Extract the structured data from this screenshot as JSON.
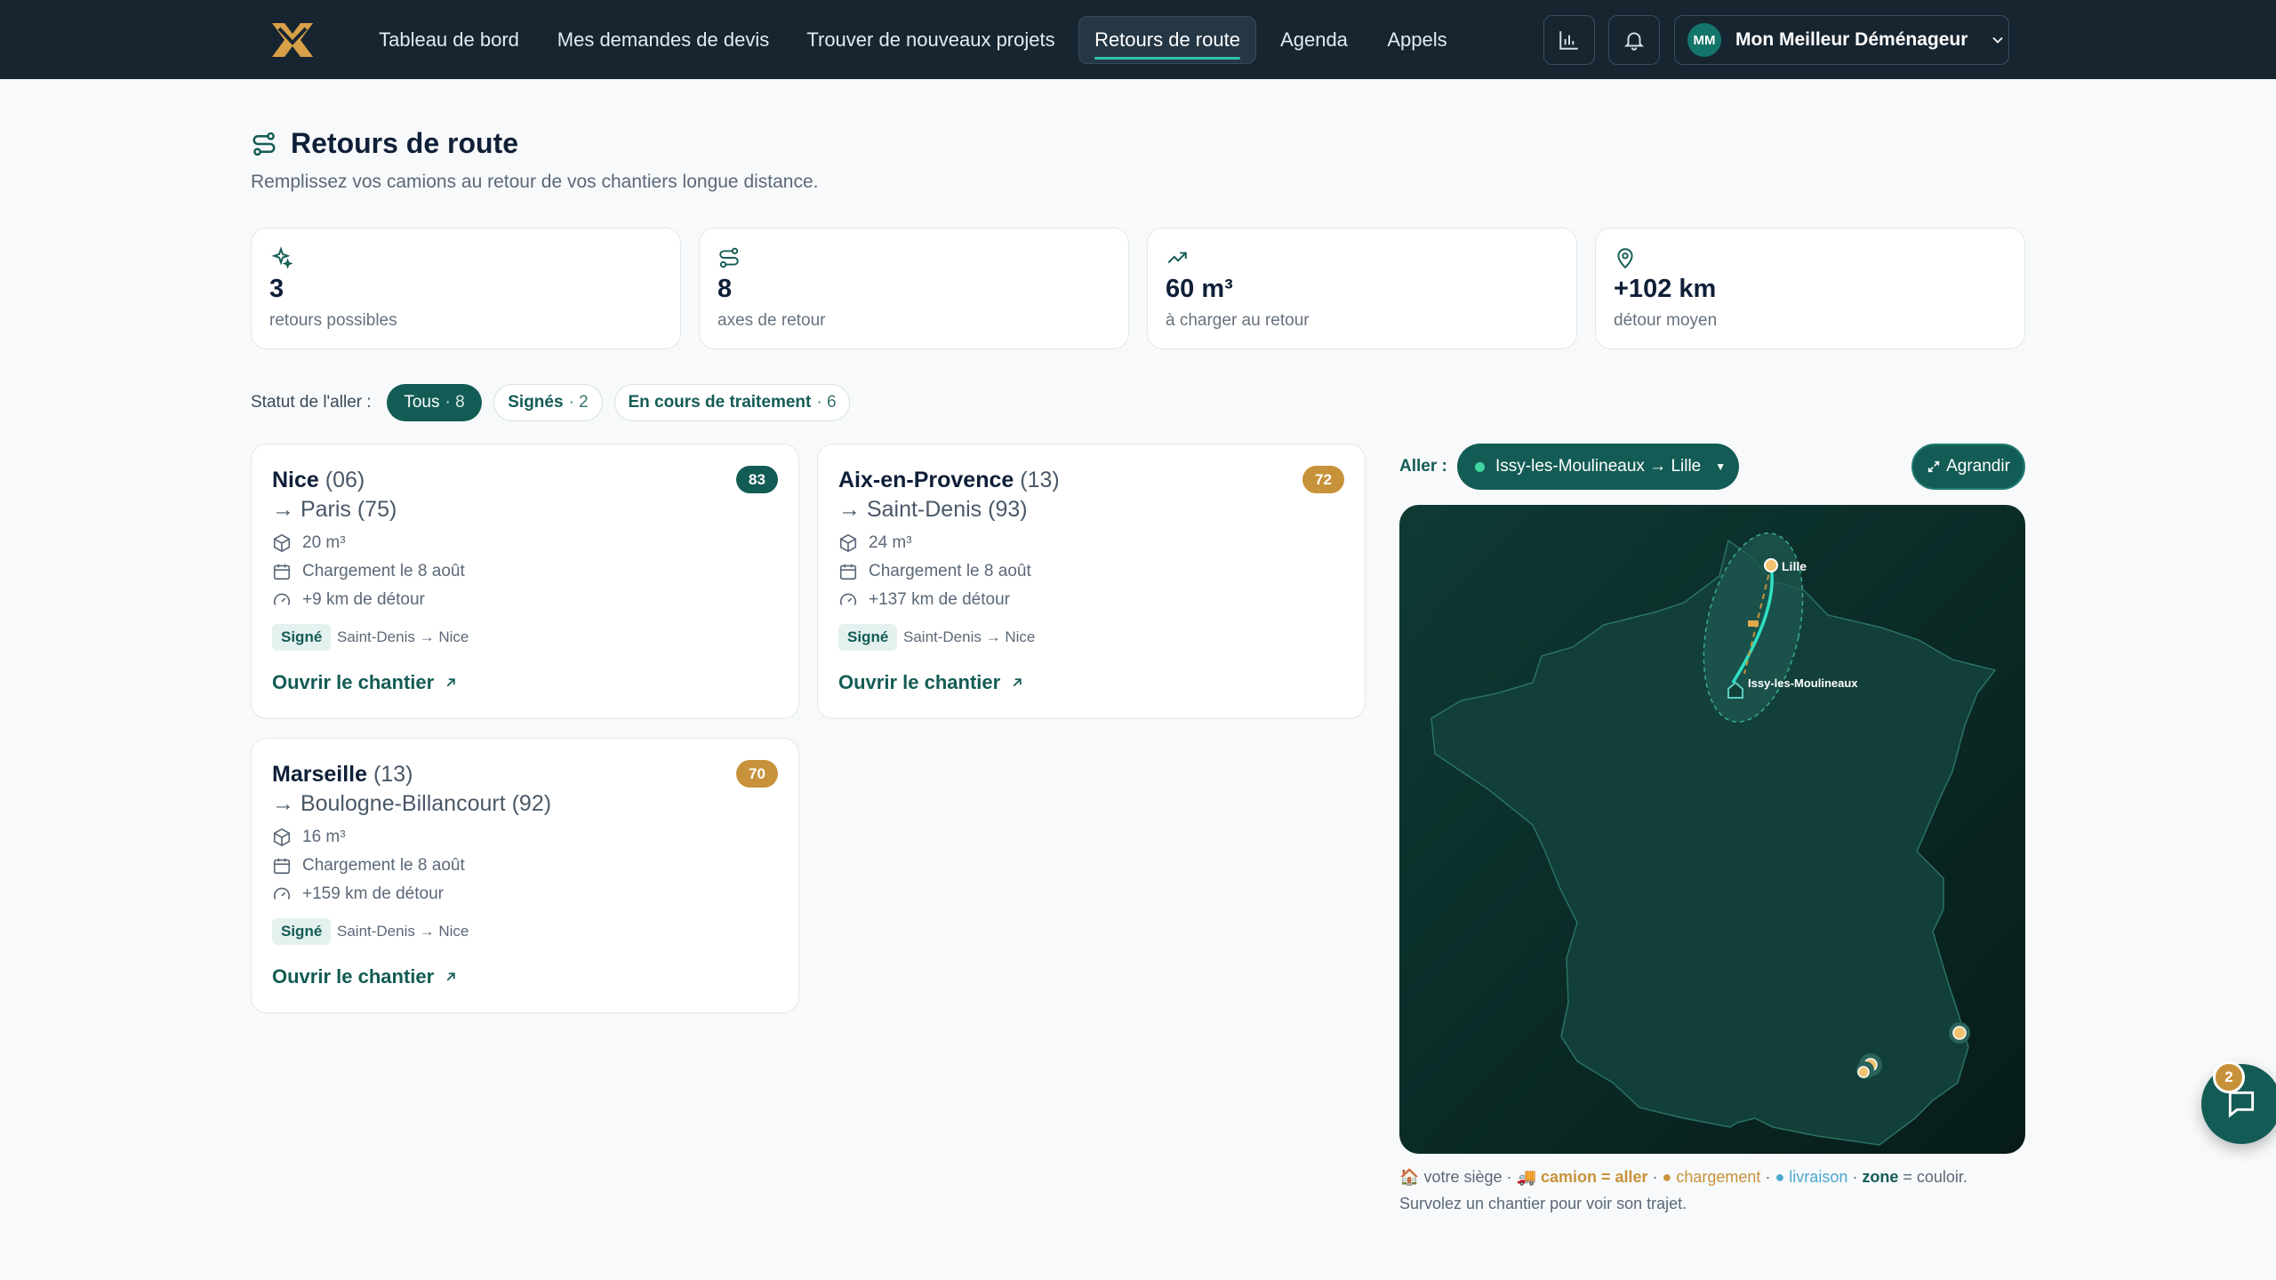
{
  "brand": {
    "accent": "#135c55",
    "gold": "#c8923a",
    "topbar": "#172531"
  },
  "nav": [
    {
      "label": "Tableau de bord"
    },
    {
      "label": "Mes demandes de devis"
    },
    {
      "label": "Trouver de nouveaux projets"
    },
    {
      "label": "Retours de route"
    },
    {
      "label": "Agenda"
    },
    {
      "label": "Appels"
    }
  ],
  "nav_active": "Retours de route",
  "user": {
    "initials": "MM",
    "name": "Mon Meilleur Déménageur"
  },
  "page": {
    "title": "Retours de route",
    "subtitle": "Remplissez vos camions au retour de vos chantiers longue distance."
  },
  "stats": [
    {
      "icon": "sparkles-icon",
      "value": "3",
      "label": "retours possibles"
    },
    {
      "icon": "route-icon",
      "value": "8",
      "label": "axes de retour"
    },
    {
      "icon": "trend-up-icon",
      "value": "60 m³",
      "label": "à charger au retour"
    },
    {
      "icon": "map-pin-icon",
      "value": "+102 km",
      "label": "détour moyen"
    }
  ],
  "filter": {
    "label": "Statut de l'aller :",
    "pills": [
      {
        "label": "Tous",
        "count": "· 8",
        "active": true
      },
      {
        "label": "Signés",
        "count": "· 2",
        "active": false
      },
      {
        "label": "En cours de traitement",
        "count": "· 6",
        "active": false
      }
    ]
  },
  "cards": [
    {
      "from": "Nice",
      "from_dept": "(06)",
      "to": "→ Paris (75)",
      "score": "83",
      "score_color": "#135c55",
      "volume": "20 m³",
      "date": "Chargement le 8 août",
      "detour": "+9 km de détour",
      "status": "Signé",
      "route": "Saint-Denis → Nice",
      "link": "Ouvrir le chantier"
    },
    {
      "from": "Aix-en-Provence",
      "from_dept": "(13)",
      "to": "→ Saint-Denis (93)",
      "score": "72",
      "score_color": "#c8923a",
      "volume": "24 m³",
      "date": "Chargement le 8 août",
      "detour": "+137 km de détour",
      "status": "Signé",
      "route": "Saint-Denis → Nice",
      "link": "Ouvrir le chantier"
    },
    {
      "from": "Marseille",
      "from_dept": "(13)",
      "to": "→ Boulogne-Billancourt (92)",
      "score": "70",
      "score_color": "#c8923a",
      "volume": "16 m³",
      "date": "Chargement le 8 août",
      "detour": "+159 km de détour",
      "status": "Signé",
      "route": "Saint-Denis → Nice",
      "link": "Ouvrir le chantier"
    }
  ],
  "map": {
    "aller_label": "Aller :",
    "aller_value": "Issy-les-Moulineaux → Lille",
    "enlarge": "Agrandir",
    "cities": {
      "north": "Lille",
      "home": "Issy-les-Moulineaux"
    },
    "legend": {
      "home": "votre siège ·",
      "truck": "camion = aller",
      "loading": "● chargement",
      "delivery": "● livraison",
      "zone": "zone",
      "zone_rest": "= couloir.",
      "hint": "Survolez un chantier pour voir son trajet."
    }
  },
  "chat": {
    "badge": "2"
  }
}
